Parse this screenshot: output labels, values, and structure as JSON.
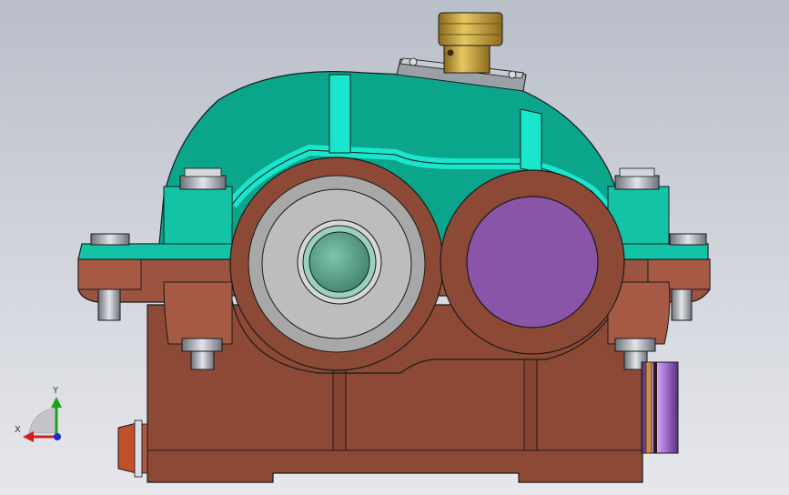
{
  "viewport": {
    "background_top": "#b9bec9",
    "background_bottom": "#e6e7ec"
  },
  "model": {
    "cover_color": "#0aa58a",
    "cover_highlight": "#19e6cd",
    "base_color": "#8c4a36",
    "base_shadow": "#7a3e2c",
    "flange_color": "#a65a44",
    "bearing_gray": "#a8a8a8",
    "shaft_green": "#5fa08a",
    "cap_purple": "#8a55a8",
    "breather_brass": "#c8a845",
    "bolt_gray": "#b8bcc4",
    "edge_color": "#1a1a1a"
  },
  "triad": {
    "y_label": "Y",
    "x_label": "X",
    "y_color": "#1aa31a",
    "x_color": "#d21e1e",
    "z_color": "#1a2ad2"
  }
}
